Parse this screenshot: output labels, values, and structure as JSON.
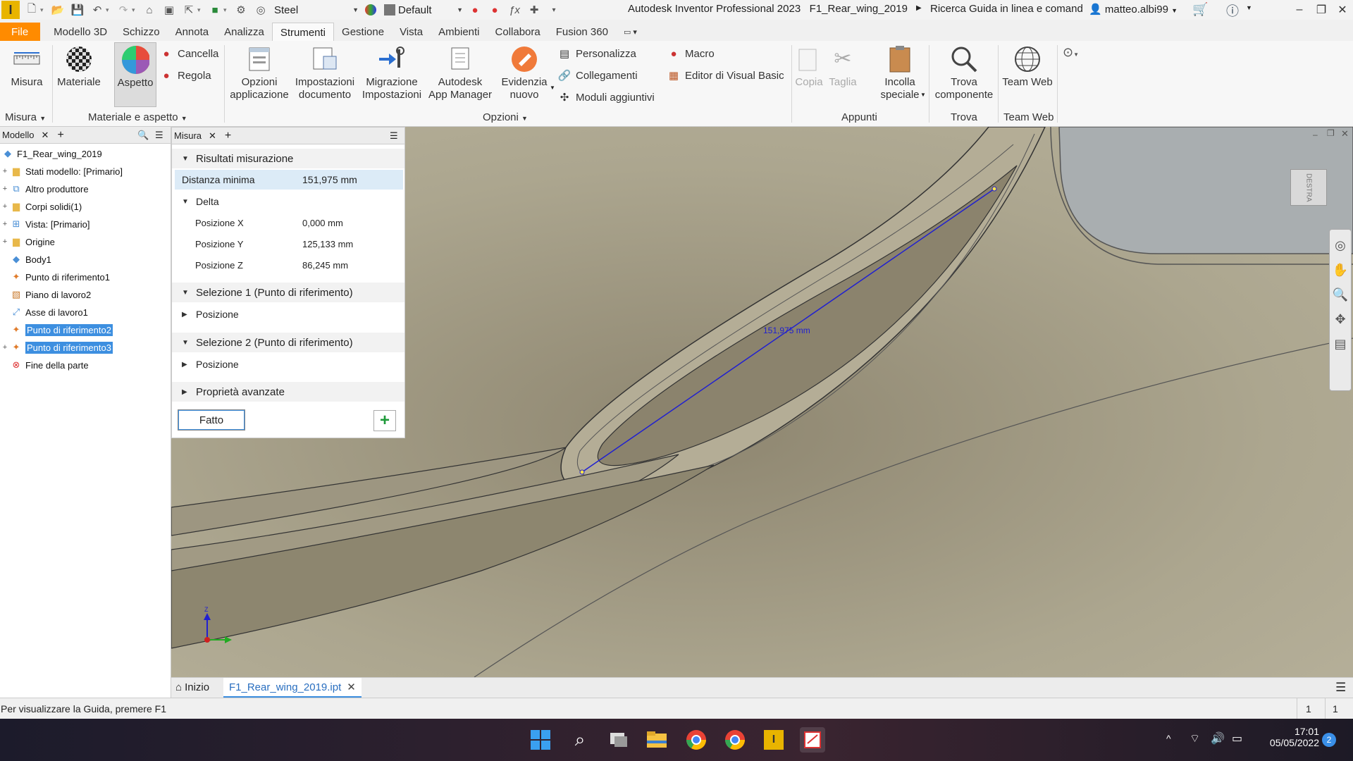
{
  "titlebar": {
    "material": "Steel",
    "appearance": "Default",
    "window_title": "Autodesk Inventor Professional 2023",
    "document": "F1_Rear_wing_2019",
    "help_search": "Ricerca Guida in linea e comand",
    "user": "matteo.albi99"
  },
  "ribbon_tabs": [
    "File",
    "Modello 3D",
    "Schizzo",
    "Annota",
    "Analizza",
    "Strumenti",
    "Gestione",
    "Vista",
    "Ambienti",
    "Collabora",
    "Fusion 360"
  ],
  "ribbon": {
    "misura": "Misura",
    "materiale": "Materiale",
    "aspetto": "Aspetto",
    "cancella": "Cancella",
    "regola": "Regola",
    "opzioni_app_1": "Opzioni",
    "opzioni_app_2": "applicazione",
    "impostazioni_doc_1": "Impostazioni",
    "impostazioni_doc_2": "documento",
    "migrazione_1": "Migrazione",
    "migrazione_2": "Impostazioni",
    "app_manager_1": "Autodesk",
    "app_manager_2": "App Manager",
    "evidenzia_1": "Evidenzia",
    "evidenzia_2": "nuovo",
    "personalizza": "Personalizza",
    "collegamenti": "Collegamenti",
    "moduli": "Moduli aggiuntivi",
    "macro": "Macro",
    "vba": "Editor di Visual Basic",
    "copia": "Copia",
    "taglia": "Taglia",
    "incolla_1": "Incolla",
    "incolla_2": "speciale",
    "trova_1": "Trova",
    "trova_2": "componente",
    "team_web": "Team Web",
    "panel_misura": "Misura",
    "panel_materiale": "Materiale e aspetto",
    "panel_opzioni": "Opzioni",
    "panel_appunti": "Appunti",
    "panel_trova": "Trova",
    "panel_teamweb": "Team Web"
  },
  "model_browser": {
    "tab": "Modello",
    "items": [
      {
        "label": "F1_Rear_wing_2019"
      },
      {
        "label": "Stati modello: [Primario]"
      },
      {
        "label": "Altro produttore"
      },
      {
        "label": "Corpi solidi(1)"
      },
      {
        "label": "Vista: [Primario]"
      },
      {
        "label": "Origine"
      },
      {
        "label": "Body1"
      },
      {
        "label": "Punto di riferimento1"
      },
      {
        "label": "Piano di lavoro2"
      },
      {
        "label": "Asse di lavoro1"
      },
      {
        "label": "Punto di riferimento2"
      },
      {
        "label": "Punto di riferimento3"
      },
      {
        "label": "Fine della parte"
      }
    ]
  },
  "measure": {
    "tab": "Misura",
    "results_header": "Risultati misurazione",
    "min_distance_label": "Distanza minima",
    "min_distance_value": "151,975 mm",
    "delta_header": "Delta",
    "pos_x_label": "Posizione X",
    "pos_x_value": "0,000 mm",
    "pos_y_label": "Posizione Y",
    "pos_y_value": "125,133 mm",
    "pos_z_label": "Posizione Z",
    "pos_z_value": "86,245 mm",
    "sel1_header": "Selezione 1 (Punto di riferimento)",
    "sel1_pos": "Posizione",
    "sel2_header": "Selezione 2 (Punto di riferimento)",
    "sel2_pos": "Posizione",
    "advanced": "Proprietà avanzate",
    "done": "Fatto"
  },
  "viewport": {
    "dimension_label": "151,975 mm",
    "viewcube_face": "DESTRA",
    "axis_z": "Z"
  },
  "doc_tabs": {
    "home": "Inizio",
    "file": "F1_Rear_wing_2019.ipt"
  },
  "status": {
    "message": "Per visualizzare la Guida, premere F1",
    "count1": "1",
    "count2": "1"
  },
  "taskbar": {
    "time": "17:01",
    "date": "05/05/2022",
    "notifications": "2"
  }
}
